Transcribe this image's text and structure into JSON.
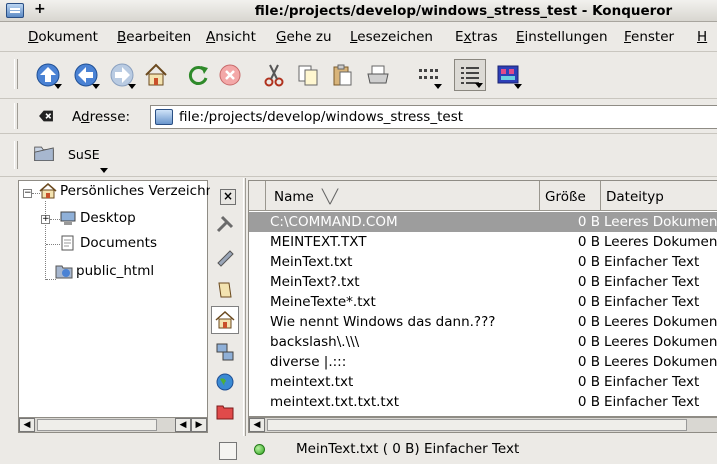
{
  "window": {
    "title": "file:/projects/develop/windows_stress_test - Konqueror",
    "pin": "+"
  },
  "menu": [
    {
      "pre": "",
      "acc": "D",
      "post": "okument"
    },
    {
      "pre": "",
      "acc": "B",
      "post": "earbeiten"
    },
    {
      "pre": "",
      "acc": "A",
      "post": "nsicht"
    },
    {
      "pre": "",
      "acc": "G",
      "post": "ehe zu"
    },
    {
      "pre": "",
      "acc": "L",
      "post": "esezeichen"
    },
    {
      "pre": "E",
      "acc": "x",
      "post": "tras"
    },
    {
      "pre": "",
      "acc": "E",
      "post": "instellungen"
    },
    {
      "pre": "",
      "acc": "F",
      "post": "enster"
    },
    {
      "pre": "",
      "acc": "H",
      "post": ""
    }
  ],
  "toolbar_icons": [
    "up-arrow-icon",
    "back-arrow-icon",
    "forward-arrow-icon",
    "home-icon",
    "reload-icon",
    "stop-icon",
    "cut-icon",
    "copy-icon",
    "paste-icon",
    "print-icon",
    "icon-view-icon",
    "detail-view-icon",
    "image-view-icon"
  ],
  "location": {
    "label_pre": "A",
    "label_acc": "d",
    "label_post": "resse:",
    "value": "file:/projects/develop/windows_stress_test"
  },
  "bookmarks": {
    "item": "SuSE"
  },
  "tree": {
    "root": "Persönliches Verzeichnis",
    "children": [
      "Desktop",
      "Documents",
      "public_html"
    ]
  },
  "columns": {
    "name": "Name",
    "size": "Größe",
    "type": "Dateityp"
  },
  "files": [
    {
      "name": "C:\\COMMAND.COM",
      "size": "0 B",
      "type": "Leeres Dokument"
    },
    {
      "name": "MEINTEXT.TXT",
      "size": "0 B",
      "type": "Leeres Dokument"
    },
    {
      "name": "MeinText.txt",
      "size": "0 B",
      "type": "Einfacher Text"
    },
    {
      "name": "MeinText?.txt",
      "size": "0 B",
      "type": "Einfacher Text"
    },
    {
      "name": "MeineTexte*.txt",
      "size": "0 B",
      "type": "Einfacher Text"
    },
    {
      "name": "Wie nennt Windows das dann.???",
      "size": "0 B",
      "type": "Leeres Dokument"
    },
    {
      "name": "backslash\\.\\\\\\",
      "size": "0 B",
      "type": "Leeres Dokument"
    },
    {
      "name": "diverse |.:::",
      "size": "0 B",
      "type": "Leeres Dokument"
    },
    {
      "name": "meintext.txt",
      "size": "0 B",
      "type": "Einfacher Text"
    },
    {
      "name": "meintext.txt.txt.txt",
      "size": "0 B",
      "type": "Einfacher Text"
    }
  ],
  "status": {
    "text": "MeinText.txt ( 0 B)  Einfacher Text"
  },
  "colors": {
    "selection": "#9d9d9d",
    "background": "#eceae6"
  }
}
